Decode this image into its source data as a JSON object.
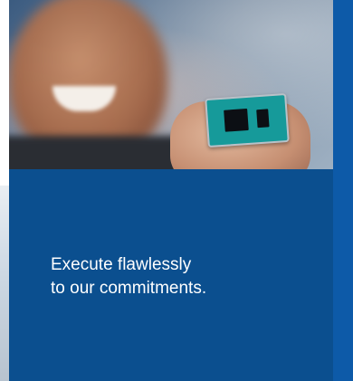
{
  "card": {
    "line1": "Execute flawlessly",
    "line2": "to our commitments."
  },
  "colors": {
    "card_background": "#0b4f8f",
    "accent_blue": "#0d5aa8",
    "text": "#ffffff"
  }
}
